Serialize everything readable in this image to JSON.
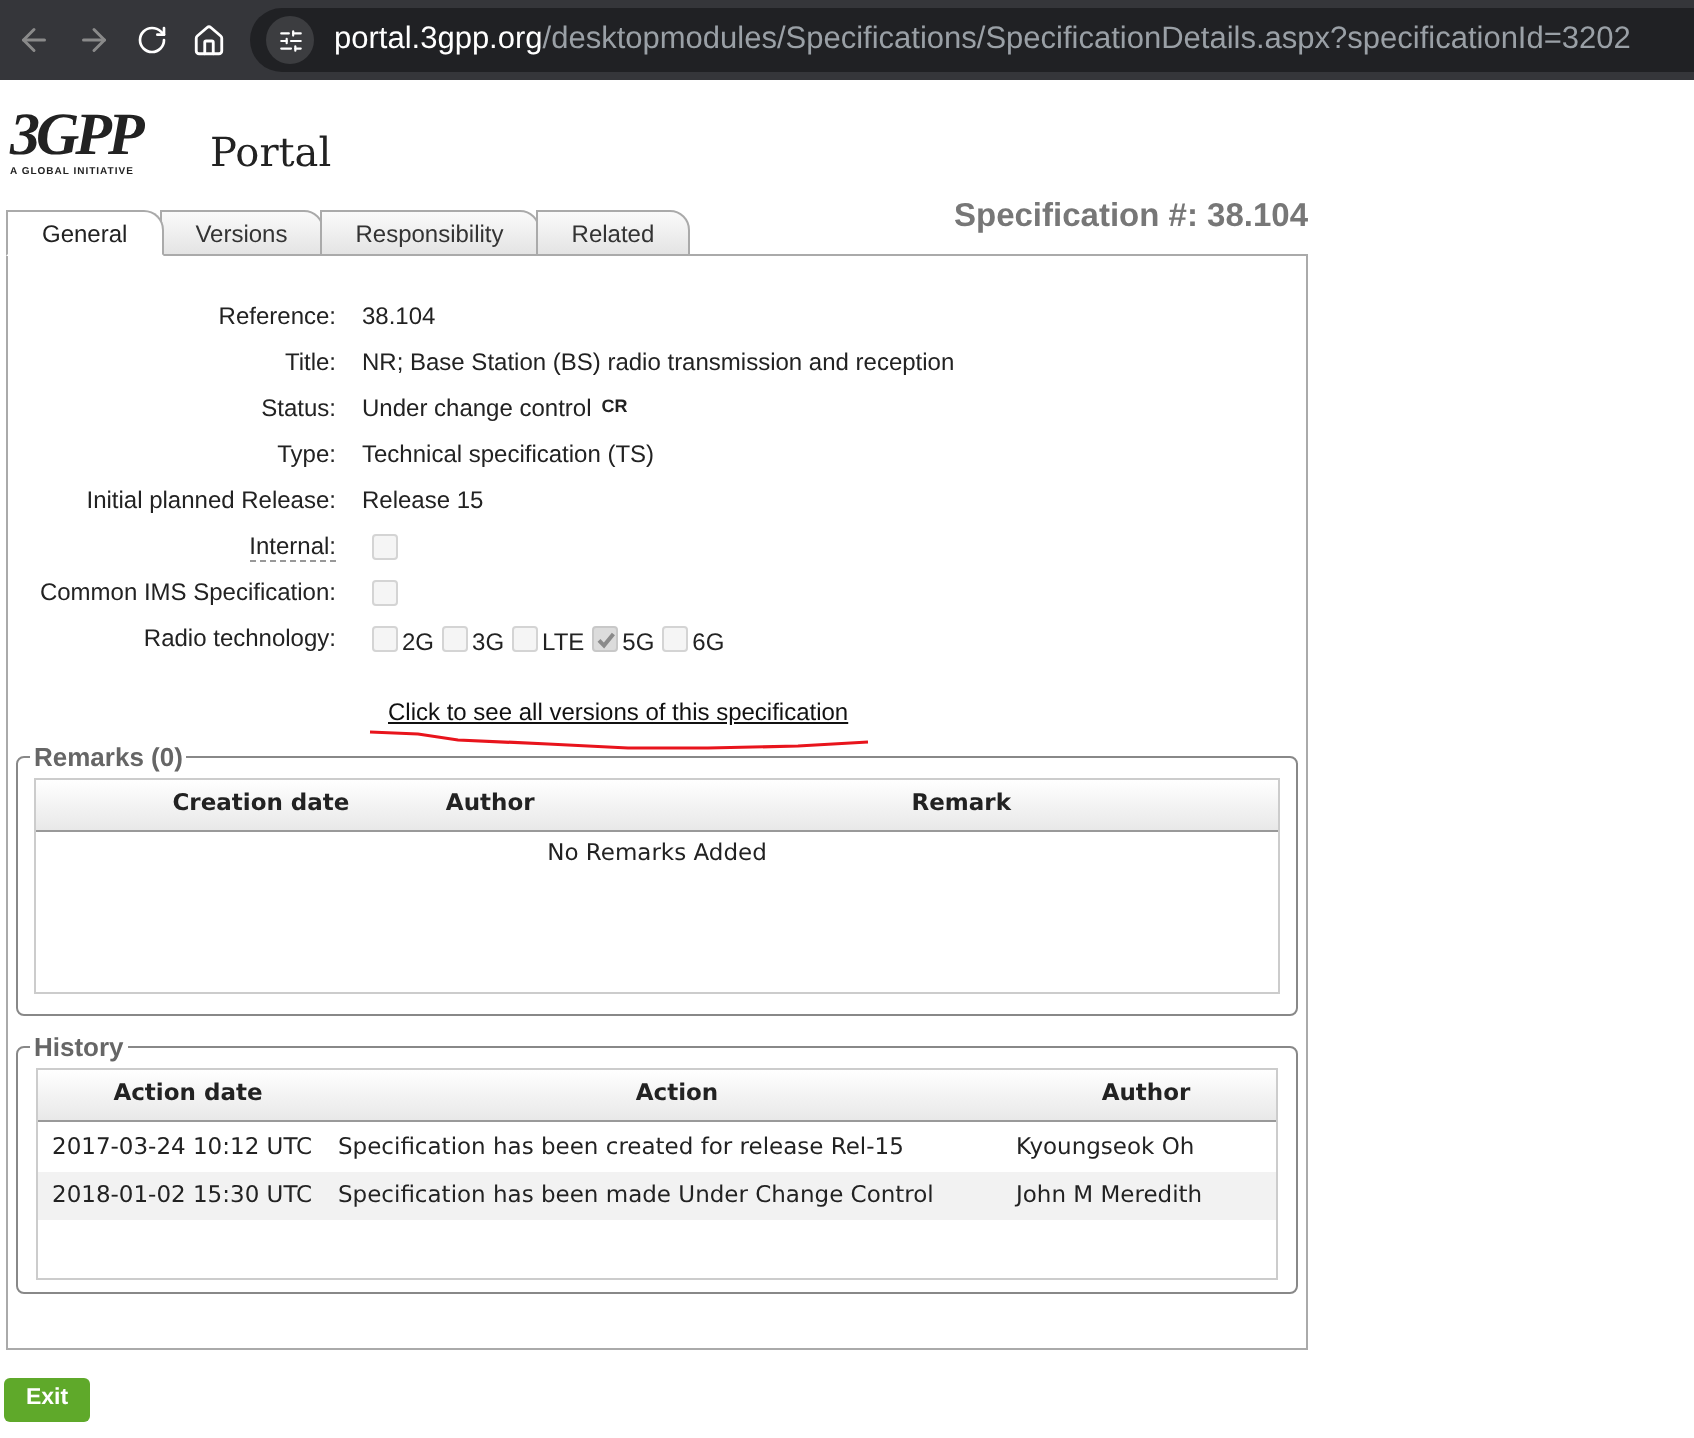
{
  "browser": {
    "url_host": "portal.3gpp.org",
    "url_path": "/desktopmodules/Specifications/SpecificationDetails.aspx?specificationId=3202"
  },
  "logo": {
    "mark": "3GPP",
    "tagline": "A GLOBAL INITIATIVE",
    "portal": "Portal"
  },
  "tabs": [
    {
      "label": "General",
      "selected": true
    },
    {
      "label": "Versions",
      "selected": false
    },
    {
      "label": "Responsibility",
      "selected": false
    },
    {
      "label": "Related",
      "selected": false
    }
  ],
  "spec_number": "Specification #: 38.104",
  "fields": [
    {
      "kind": "text",
      "label": "Reference:",
      "value": "38.104"
    },
    {
      "kind": "text",
      "label": "Title:",
      "value": "NR; Base Station (BS) radio transmission and reception"
    },
    {
      "kind": "text",
      "label": "Status:",
      "value": "Under change control",
      "badge": "CR"
    },
    {
      "kind": "text",
      "label": "Type:",
      "value": "Technical specification (TS)"
    },
    {
      "kind": "text",
      "label": "Initial planned Release:",
      "value": "Release 15"
    },
    {
      "kind": "checkbox",
      "label": "Internal:",
      "has_tooltip": true,
      "checked": false,
      "disabled": true
    },
    {
      "kind": "checkbox",
      "label": "Common IMS Specification:",
      "has_tooltip": false,
      "checked": false,
      "disabled": true
    },
    {
      "kind": "checkbox_group",
      "label": "Radio technology:",
      "options": [
        {
          "label": "2G",
          "checked": false,
          "disabled": true
        },
        {
          "label": "3G",
          "checked": false,
          "disabled": true
        },
        {
          "label": "LTE",
          "checked": false,
          "disabled": true
        },
        {
          "label": "5G",
          "checked": true,
          "disabled": true
        },
        {
          "label": "6G",
          "checked": false,
          "disabled": true
        }
      ]
    }
  ],
  "versions_link": "Click to see all versions of this specification",
  "remarks": {
    "title": "Remarks (0)",
    "columns": [
      "Creation date",
      "Author",
      "Remark"
    ],
    "empty_text": "No Remarks Added"
  },
  "history": {
    "title": "History",
    "columns": [
      "Action date",
      "Action",
      "Author"
    ],
    "rows": [
      [
        "2017-03-24 10:12 UTC",
        "Specification has been created for release Rel-15",
        "Kyoungseok Oh"
      ],
      [
        "2018-01-02 15:30 UTC",
        "Specification has been made Under Change Control",
        "John M Meredith"
      ]
    ]
  },
  "exit_button": "Exit"
}
